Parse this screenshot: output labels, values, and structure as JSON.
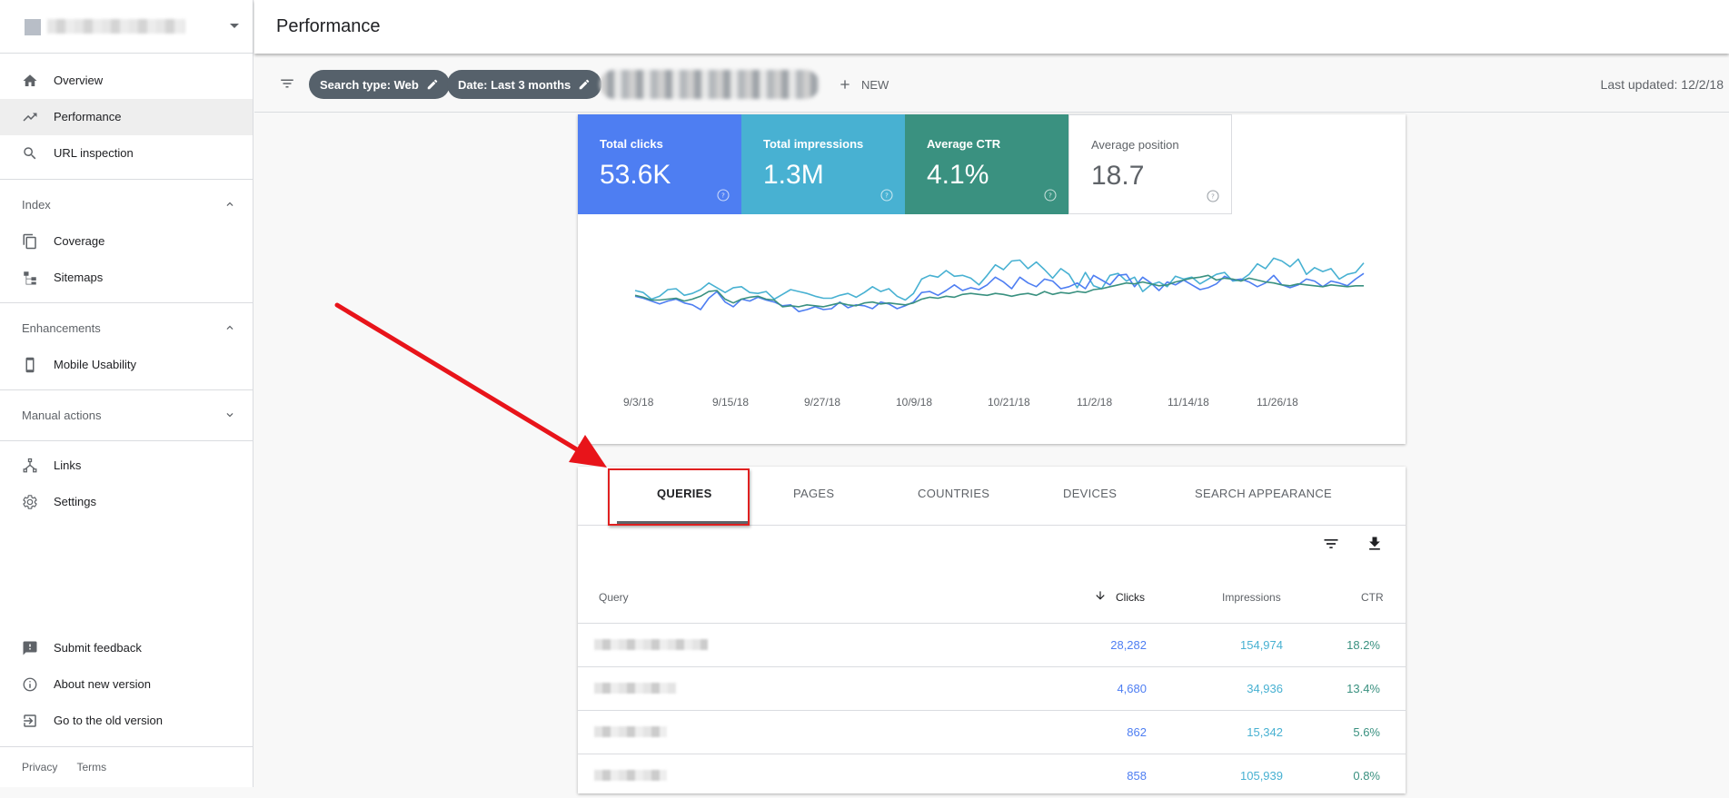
{
  "sidebar": {
    "items": [
      {
        "label": "Overview",
        "icon": "home-icon"
      },
      {
        "label": "Performance",
        "icon": "trending-up-icon"
      },
      {
        "label": "URL inspection",
        "icon": "search-icon"
      }
    ],
    "index": {
      "title": "Index",
      "items": [
        {
          "label": "Coverage",
          "icon": "coverage-icon"
        },
        {
          "label": "Sitemaps",
          "icon": "sitemap-icon"
        }
      ]
    },
    "enhancements": {
      "title": "Enhancements",
      "items": [
        {
          "label": "Mobile Usability",
          "icon": "phone-icon"
        }
      ]
    },
    "manual_actions": {
      "title": "Manual actions"
    },
    "other": [
      {
        "label": "Links",
        "icon": "links-icon"
      },
      {
        "label": "Settings",
        "icon": "gear-icon"
      }
    ],
    "bottom": [
      {
        "label": "Submit feedback",
        "icon": "feedback-icon"
      },
      {
        "label": "About new version",
        "icon": "info-icon"
      },
      {
        "label": "Go to the old version",
        "icon": "exit-icon"
      }
    ],
    "footer": {
      "privacy": "Privacy",
      "terms": "Terms"
    }
  },
  "header": {
    "title": "Performance"
  },
  "filters": {
    "chips": [
      "Search type: Web",
      "Date: Last 3 months"
    ],
    "new_label": "NEW",
    "last_updated": "Last updated: 12/2/18"
  },
  "metrics": [
    {
      "label": "Total clicks",
      "value": "53.6K",
      "color": "#4e7ef2",
      "active": true
    },
    {
      "label": "Total impressions",
      "value": "1.3M",
      "color": "#48b1d2",
      "active": true
    },
    {
      "label": "Average CTR",
      "value": "4.1%",
      "color": "#3a9180",
      "active": true
    },
    {
      "label": "Average position",
      "value": "18.7",
      "color": "#ffffff",
      "active": false
    }
  ],
  "chart_data": {
    "type": "line",
    "x_ticks": [
      "9/3/18",
      "9/15/18",
      "9/27/18",
      "10/9/18",
      "10/21/18",
      "11/2/18",
      "11/14/18",
      "11/26/18"
    ],
    "x_range": [
      "9/3/18",
      "12/1/18"
    ],
    "grid": false,
    "series": [
      {
        "color": "#48b1d2",
        "values": [
          0.39,
          0.37,
          0.3,
          0.33,
          0.4,
          0.41,
          0.34,
          0.36,
          0.4,
          0.47,
          0.42,
          0.37,
          0.42,
          0.43,
          0.37,
          0.36,
          0.38,
          0.3,
          0.35,
          0.4,
          0.38,
          0.36,
          0.33,
          0.31,
          0.31,
          0.34,
          0.36,
          0.32,
          0.37,
          0.43,
          0.38,
          0.41,
          0.33,
          0.29,
          0.36,
          0.51,
          0.55,
          0.53,
          0.6,
          0.54,
          0.55,
          0.52,
          0.45,
          0.55,
          0.66,
          0.61,
          0.7,
          0.71,
          0.62,
          0.69,
          0.61,
          0.52,
          0.62,
          0.56,
          0.42,
          0.58,
          0.44,
          0.41,
          0.55,
          0.57,
          0.49,
          0.53,
          0.38,
          0.45,
          0.48,
          0.43,
          0.54,
          0.51,
          0.53,
          0.46,
          0.51,
          0.56,
          0.58,
          0.49,
          0.5,
          0.56,
          0.67,
          0.62,
          0.73,
          0.7,
          0.64,
          0.72,
          0.56,
          0.63,
          0.59,
          0.62,
          0.51,
          0.56,
          0.58,
          0.68
        ]
      },
      {
        "color": "#4e7ef2",
        "values": [
          0.33,
          0.31,
          0.28,
          0.25,
          0.28,
          0.3,
          0.26,
          0.24,
          0.19,
          0.31,
          0.38,
          0.27,
          0.22,
          0.3,
          0.28,
          0.32,
          0.29,
          0.27,
          0.23,
          0.24,
          0.17,
          0.19,
          0.22,
          0.19,
          0.2,
          0.27,
          0.21,
          0.24,
          0.23,
          0.2,
          0.27,
          0.25,
          0.2,
          0.23,
          0.27,
          0.37,
          0.38,
          0.34,
          0.39,
          0.45,
          0.39,
          0.42,
          0.4,
          0.45,
          0.53,
          0.48,
          0.41,
          0.53,
          0.47,
          0.43,
          0.51,
          0.49,
          0.41,
          0.43,
          0.47,
          0.41,
          0.55,
          0.5,
          0.45,
          0.55,
          0.56,
          0.43,
          0.53,
          0.47,
          0.39,
          0.48,
          0.45,
          0.5,
          0.45,
          0.4,
          0.42,
          0.46,
          0.54,
          0.5,
          0.51,
          0.48,
          0.43,
          0.47,
          0.55,
          0.45,
          0.42,
          0.45,
          0.51,
          0.49,
          0.43,
          0.49,
          0.47,
          0.44,
          0.51,
          0.57
        ]
      },
      {
        "color": "#3a9180",
        "values": [
          0.34,
          0.32,
          0.29,
          0.29,
          0.3,
          0.31,
          0.28,
          0.3,
          0.33,
          0.38,
          0.39,
          0.3,
          0.26,
          0.3,
          0.32,
          0.33,
          0.3,
          0.29,
          0.22,
          0.23,
          0.22,
          0.24,
          0.23,
          0.22,
          0.24,
          0.26,
          0.24,
          0.23,
          0.26,
          0.27,
          0.25,
          0.26,
          0.25,
          0.24,
          0.26,
          0.3,
          0.32,
          0.31,
          0.33,
          0.32,
          0.35,
          0.36,
          0.35,
          0.34,
          0.36,
          0.35,
          0.33,
          0.35,
          0.36,
          0.34,
          0.38,
          0.35,
          0.37,
          0.36,
          0.38,
          0.37,
          0.4,
          0.41,
          0.43,
          0.45,
          0.47,
          0.46,
          0.48,
          0.46,
          0.44,
          0.45,
          0.48,
          0.5,
          0.52,
          0.53,
          0.55,
          0.5,
          0.52,
          0.51,
          0.49,
          0.52,
          0.5,
          0.48,
          0.47,
          0.45,
          0.44,
          0.46,
          0.45,
          0.44,
          0.43,
          0.45,
          0.44,
          0.43,
          0.44,
          0.44
        ]
      }
    ]
  },
  "tabs": [
    "QUERIES",
    "PAGES",
    "COUNTRIES",
    "DEVICES",
    "SEARCH APPEARANCE"
  ],
  "table": {
    "headers": {
      "query": "Query",
      "clicks": "Clicks",
      "impressions": "Impressions",
      "ctr": "CTR"
    },
    "rows": [
      {
        "clicks": "28,282",
        "impressions": "154,974",
        "ctr": "18.2%"
      },
      {
        "clicks": "4,680",
        "impressions": "34,936",
        "ctr": "13.4%"
      },
      {
        "clicks": "862",
        "impressions": "15,342",
        "ctr": "5.6%"
      },
      {
        "clicks": "858",
        "impressions": "105,939",
        "ctr": "0.8%"
      }
    ]
  },
  "colors": {
    "clicks": "#4e7ef2",
    "impressions": "#48b1d2",
    "ctr": "#3a9180",
    "annotation": "#e02020"
  }
}
